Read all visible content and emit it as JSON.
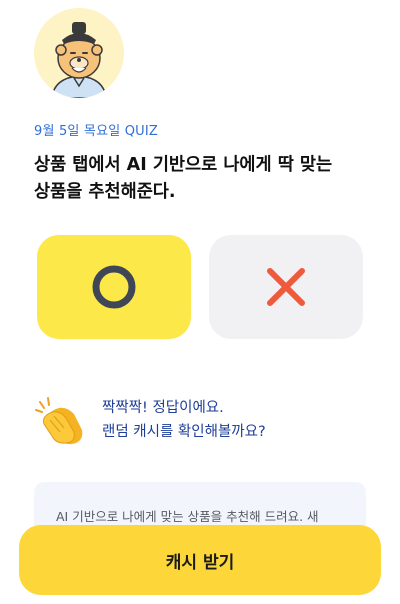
{
  "quiz": {
    "date_label": "9월 5일 목요일 QUIZ",
    "question_line1": "상품 탭에서 AI 기반으로 나에게 딱 맞는",
    "question_line2": "상품을 추천해준다."
  },
  "answers": [
    {
      "id": "o",
      "icon": "circle-o-icon",
      "selected": true,
      "color": "#fde84a"
    },
    {
      "id": "x",
      "icon": "cross-x-icon",
      "selected": false,
      "color": "#f1f1f3"
    }
  ],
  "feedback": {
    "icon": "clapping-hands-icon",
    "line1": "짝짝짝! 정답이에요.",
    "line2": "랜덤 캐시를 확인해볼까요?"
  },
  "explanation": {
    "text": "AI 기반으로 나에게 맞는 상품을 추천해 드려요. 새"
  },
  "cta": {
    "label": "캐시 받기",
    "color": "#fdd73a"
  },
  "colors": {
    "accent_blue": "#2f6fd6",
    "feedback_blue": "#1f3f99",
    "o_mark": "#3f4756",
    "x_mark": "#ef5a3c"
  }
}
